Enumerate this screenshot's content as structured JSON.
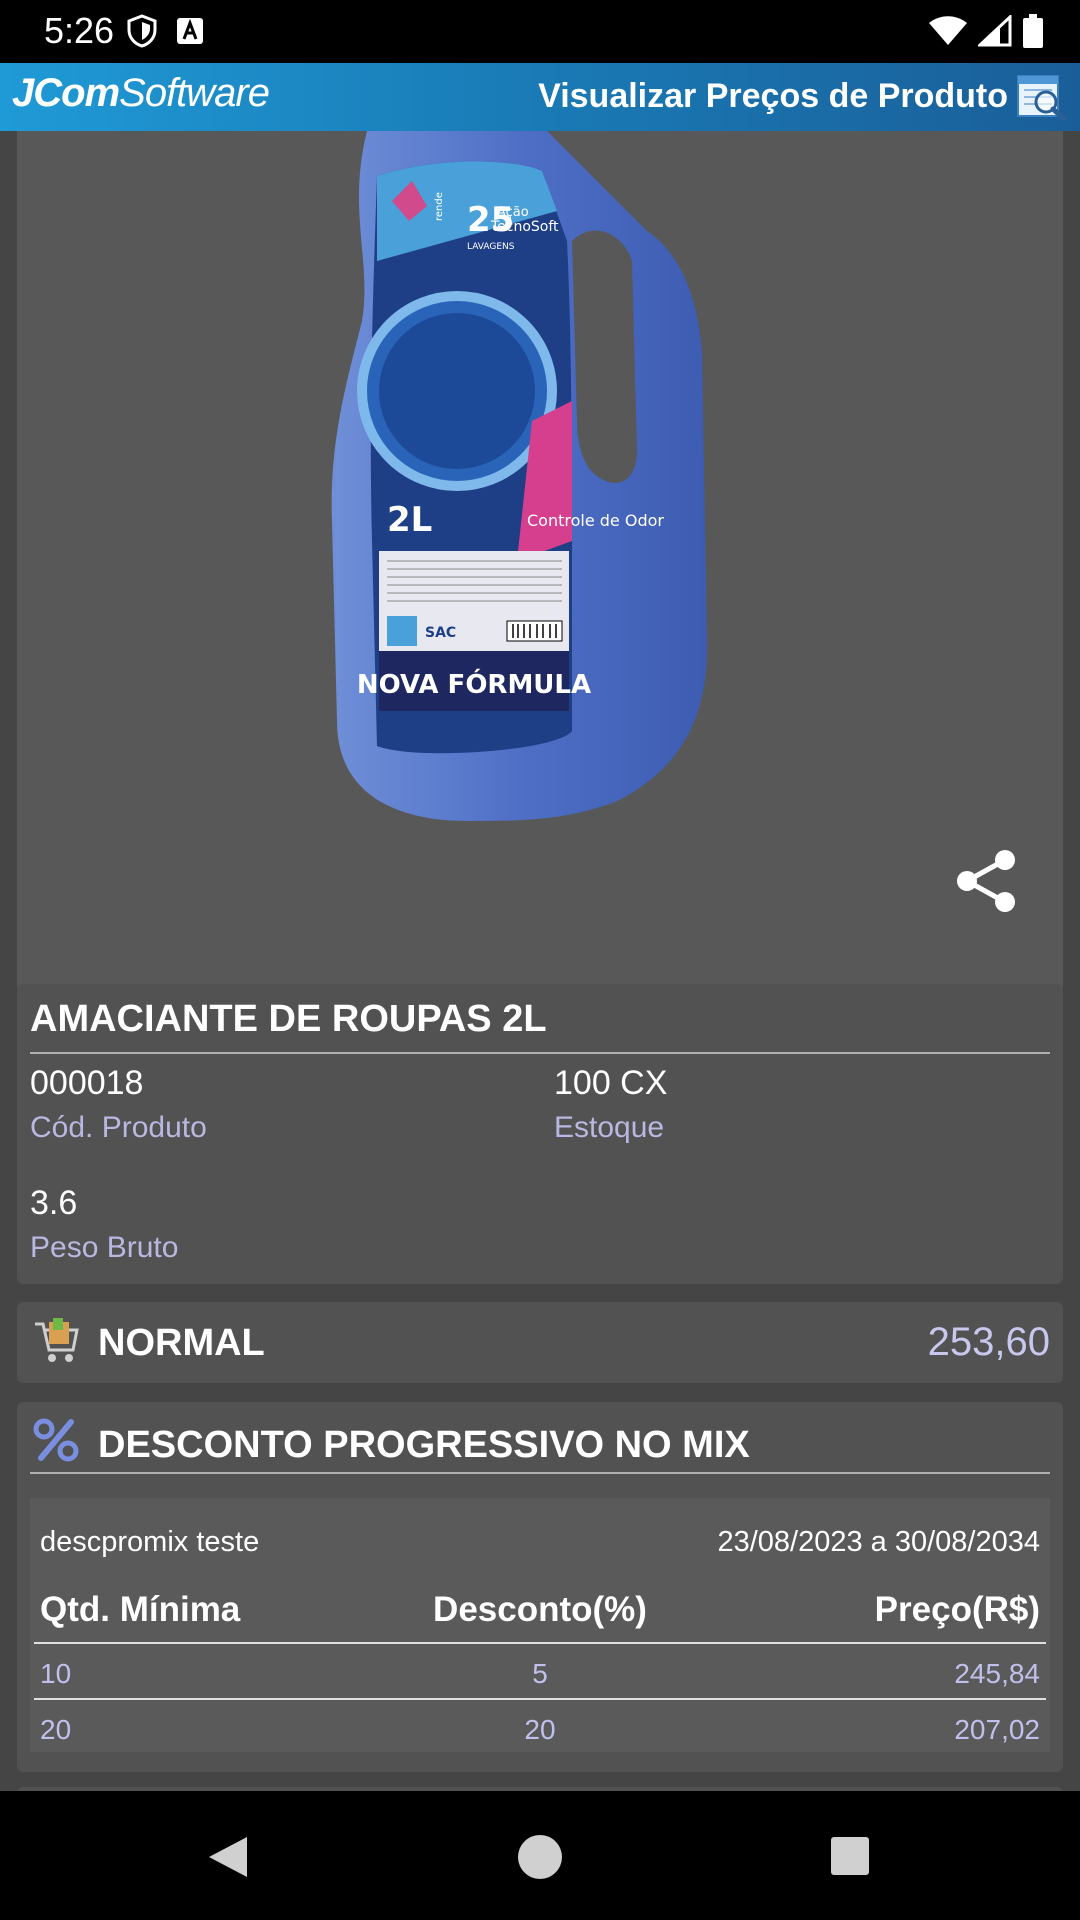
{
  "status_bar": {
    "time": "5:26",
    "icons": [
      "shield-icon",
      "a-box-icon",
      "wifi-icon",
      "signal-icon",
      "battery-icon"
    ]
  },
  "app_bar": {
    "brand_bold": "JCom",
    "brand_light": "Software",
    "title": "Visualizar Preços de Produto",
    "icon": "search-list-icon",
    "background_color": "#1a7db8"
  },
  "product": {
    "image": {
      "label_text": "NOVA FÓRMULA",
      "volume": "2L",
      "washes_prefix": "rende",
      "washes": "25",
      "washes_suffix": "LAVAGENS",
      "badge": "Controle de Odor",
      "tag_line1": "Ação",
      "tag_line2": "TecnoSoft",
      "sac": "SAC"
    },
    "title": "AMACIANTE DE ROUPAS 2L",
    "code_value": "000018",
    "code_label": "Cód. Produto",
    "stock_value": "100 CX",
    "stock_label": "Estoque",
    "weight_value": "3.6",
    "weight_label": "Peso Bruto"
  },
  "normal_price": {
    "icon": "cart-icon",
    "label": "NORMAL",
    "value": "253,60"
  },
  "discount": {
    "icon": "percent-icon",
    "title": "DESCONTO PROGRESSIVO NO MIX",
    "promo_name": "descpromix teste",
    "period": "23/08/2023 a 30/08/2034",
    "columns": [
      "Qtd. Mínima",
      "Desconto(%)",
      "Preço(R$)"
    ],
    "rows": [
      [
        "10",
        "5",
        "245,84"
      ],
      [
        "20",
        "20",
        "207,02"
      ]
    ]
  },
  "nav_bar": {
    "icons": [
      "back-icon",
      "home-icon",
      "recents-icon"
    ]
  }
}
